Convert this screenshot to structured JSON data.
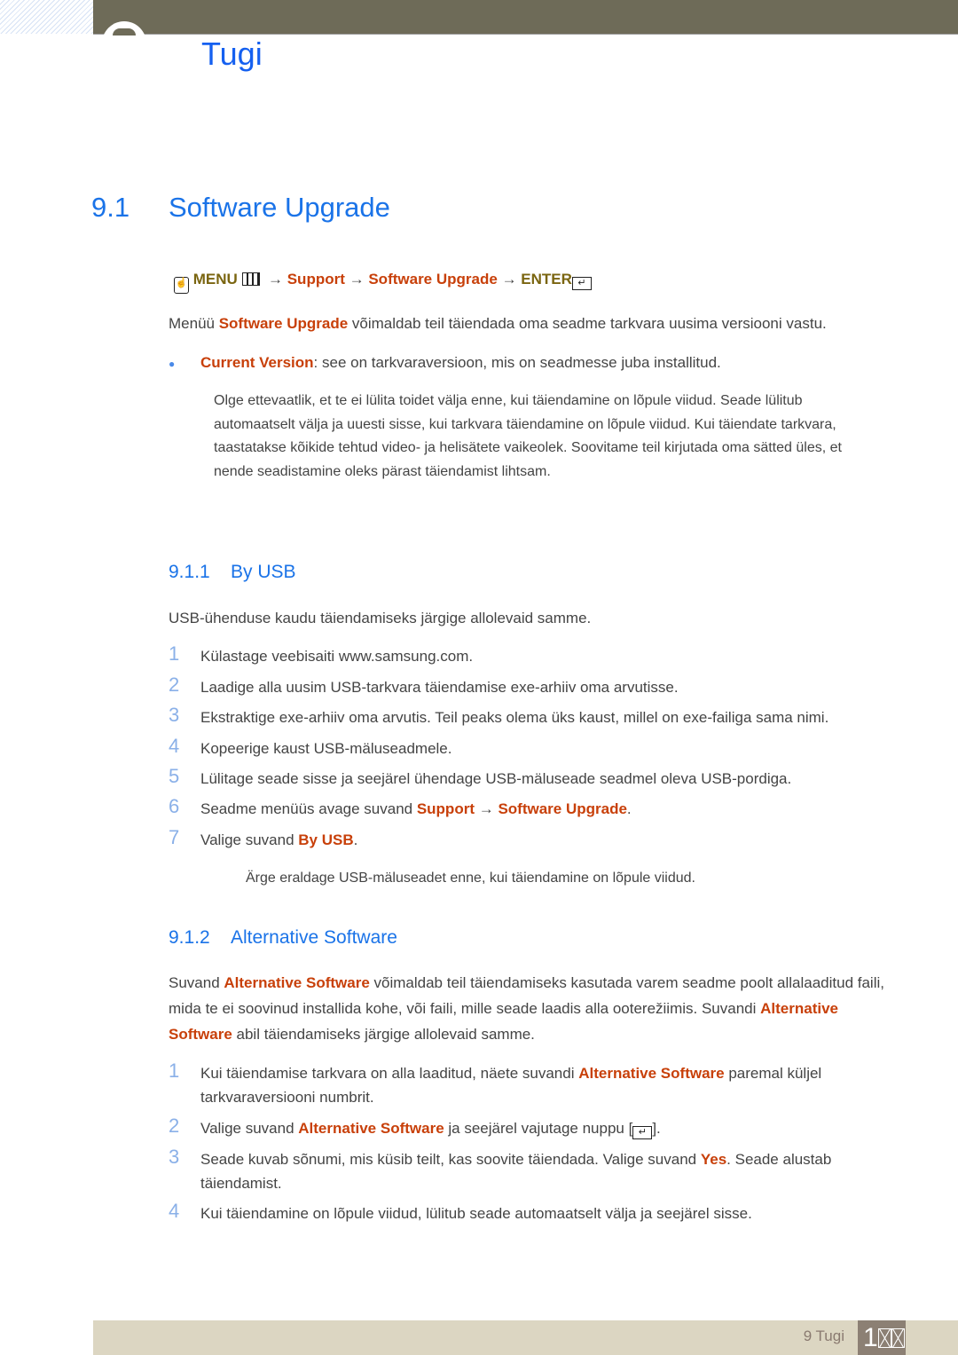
{
  "chapter": {
    "title": "Tugi"
  },
  "section": {
    "number": "9.1",
    "title": "Software Upgrade"
  },
  "menu_path": {
    "menu": "MENU",
    "arrow": "→",
    "support": "Support",
    "upgrade": "Software Upgrade",
    "enter": "ENTER"
  },
  "intro": {
    "a": "Menüü ",
    "b": "Software Upgrade",
    "c": " võimaldab teil täiendada oma seadme tarkvara uusima versiooni vastu."
  },
  "bullet": {
    "a": "Current Version",
    "b": ": see on tarkvaraversioon, mis on seadmesse juba installitud."
  },
  "note1": "Olge ettevaatlik, et te ei lülita toidet välja enne, kui täiendamine on lõpule viidud. Seade lülitub automaatselt välja ja uuesti sisse, kui tarkvara täiendamine on lõpule viidud. Kui täiendate tarkvara, taastatakse kõikide tehtud video- ja helisätete vaikeolek. Soovitame teil kirjutada oma sätted üles, et nende seadistamine oleks pärast täiendamist lihtsam.",
  "usb": {
    "number": "9.1.1",
    "title": "By USB",
    "intro": "USB-ühenduse kaudu täiendamiseks järgige allolevaid samme.",
    "steps": [
      "Külastage veebisaiti www.samsung.com.",
      "Laadige alla uusim USB-tarkvara täiendamise exe-arhiiv oma arvutisse.",
      "Ekstraktige exe-arhiiv oma arvutis. Teil peaks olema üks kaust, millel on exe-failiga sama nimi.",
      "Kopeerige kaust USB-mäluseadmele.",
      "Lülitage seade sisse ja seejärel ühendage USB-mäluseade seadmel oleva USB-pordiga."
    ],
    "step6": {
      "a": "Seadme menüüs avage suvand ",
      "b": "Support",
      "c": " → ",
      "d": "Software Upgrade",
      "e": "."
    },
    "step7": {
      "a": "Valige suvand ",
      "b": "By USB",
      "c": "."
    },
    "note": "Ärge eraldage USB-mäluseadet enne, kui täiendamine on lõpule viidud."
  },
  "alt": {
    "number": "9.1.2",
    "title": "Alternative Software",
    "intro": {
      "a": "Suvand ",
      "b": "Alternative Software",
      "c": " võimaldab teil täiendamiseks kasutada varem seadme poolt allalaaditud faili, mida te ei soovinud installida kohe, või faili, mille seade laadis alla ooterežiimis. Suvandi ",
      "d": "Alternative Software",
      "e": " abil täiendamiseks järgige allolevaid samme."
    },
    "s1": {
      "a": "Kui täiendamise tarkvara on alla laaditud, näete suvandi ",
      "b": "Alternative Software",
      "c": " paremal küljel tarkvaraversiooni numbrit."
    },
    "s2": {
      "a": "Valige suvand ",
      "b": "Alternative Software",
      "c": " ja seejärel vajutage nuppu [",
      "d": "]."
    },
    "s3": {
      "a": "Seade kuvab sõnumi, mis küsib teilt, kas soovite täiendada. Valige suvand ",
      "b": "Yes",
      "c": ". Seade alustab täiendamist."
    },
    "s4": "Kui täiendamine on lõpule viidud, lülitub seade automaatselt välja ja seejärel sisse."
  },
  "footer": {
    "label": "9 Tugi",
    "page": "1"
  },
  "colors": {
    "blue": "#1a73e8",
    "orange": "#c8400a",
    "olive": "#7a6510"
  }
}
